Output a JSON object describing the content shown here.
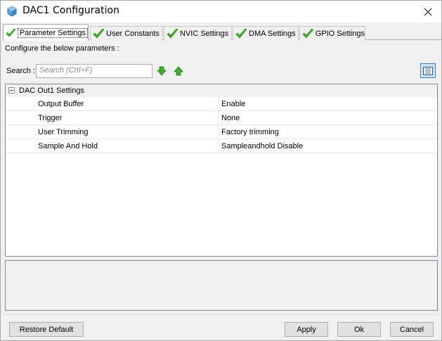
{
  "window": {
    "title": "DAC1 Configuration"
  },
  "tabs": [
    {
      "label": "Parameter Settings",
      "active": true
    },
    {
      "label": "User Constants",
      "active": false
    },
    {
      "label": "NVIC Settings",
      "active": false
    },
    {
      "label": "DMA Settings",
      "active": false
    },
    {
      "label": "GPIO Settings",
      "active": false
    }
  ],
  "panel": {
    "instructions": "Configure the below parameters :",
    "search": {
      "label": "Search :",
      "placeholder": "Search (Crtl+F)"
    }
  },
  "tree": {
    "group_label": "DAC Out1 Settings",
    "rows": [
      {
        "name": "Output Buffer",
        "value": "Enable"
      },
      {
        "name": "Trigger",
        "value": "None"
      },
      {
        "name": "User Trimming",
        "value": "Factory trimming"
      },
      {
        "name": "Sample And Hold",
        "value": "Sampleandhold Disable"
      }
    ]
  },
  "buttons": {
    "restore_default": "Restore Default",
    "apply": "Apply",
    "ok": "Ok",
    "cancel": "Cancel"
  },
  "colors": {
    "check_green": "#3fae29",
    "arrow_green": "#2e9e2e",
    "selection_blue": "#cfe4f7"
  }
}
